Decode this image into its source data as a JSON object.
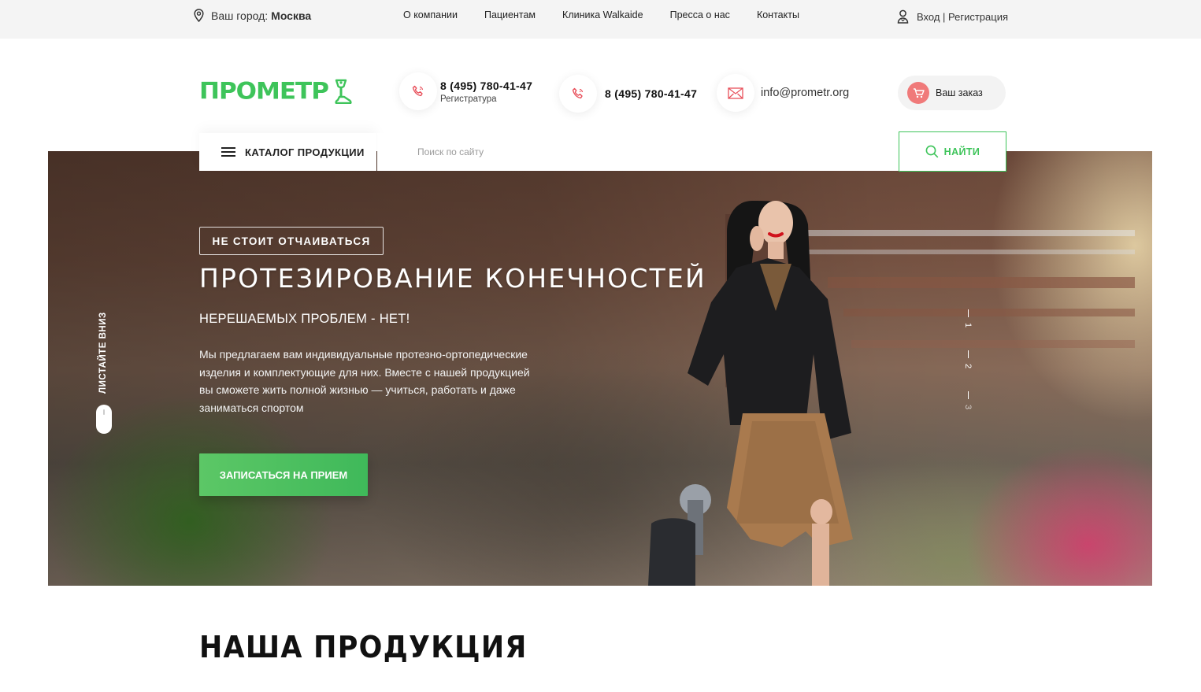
{
  "topbar": {
    "city_label": "Ваш город:",
    "city_value": "Москва",
    "nav": [
      "О компании",
      "Пациентам",
      "Клиника Walkaide",
      "Пресса о нас",
      "Контакты"
    ],
    "login": "Вход | Регистрация"
  },
  "header": {
    "logo": "ПРОМЕТР",
    "phone1": "8 (495) 780-41-47",
    "phone1_sub": "Регистратура",
    "phone2": "8 (495) 780-41-47",
    "email": "info@prometr.org",
    "order": "Ваш заказ"
  },
  "search": {
    "catalog": "КАТАЛОГ ПРОДУКЦИИ",
    "placeholder": "Поиск по сайту",
    "button": "НАЙТИ"
  },
  "hero": {
    "badge": "НЕ СТОИТ ОТЧАИВАТЬСЯ",
    "title": "ПРОТЕЗИРОВАНИЕ КОНЕЧНОСТЕЙ",
    "subtitle": "НЕРЕШАЕМЫХ ПРОБЛЕМ - НЕТ!",
    "text": "Мы предлагаем вам индивидуальные протезно-ортопедические изделия и комплектующие для них. Вместе с нашей продукцией вы сможете жить полной жизнью — учиться, работать и даже заниматься спортом",
    "cta": "ЗАПИСАТЬСЯ НА ПРИЕМ",
    "scroll_hint": "ЛИСТАЙТЕ ВНИЗ",
    "slides": [
      "1",
      "2",
      "3"
    ]
  },
  "products": {
    "title": "НАША ПРОДУКЦИЯ"
  },
  "colors": {
    "brand_green": "#3ec45a",
    "accent_red": "#f07a7a",
    "topbar_bg": "#f4f4f4"
  },
  "icons": [
    "location-pin-icon",
    "user-icon",
    "phone-icon",
    "mail-icon",
    "cart-icon",
    "burger-menu-icon",
    "search-icon",
    "logo-prosthesis-icon",
    "mouse-scroll-icon"
  ]
}
